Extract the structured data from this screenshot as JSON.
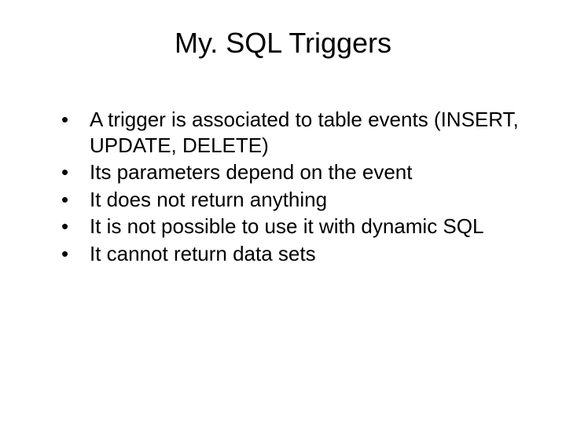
{
  "title": "My. SQL Triggers",
  "bullets": [
    "A trigger is associated to table events (INSERT, UPDATE, DELETE)",
    "Its parameters depend on the event",
    "It does not return anything",
    "It is not possible to use it with dynamic SQL",
    "It cannot return data sets"
  ]
}
